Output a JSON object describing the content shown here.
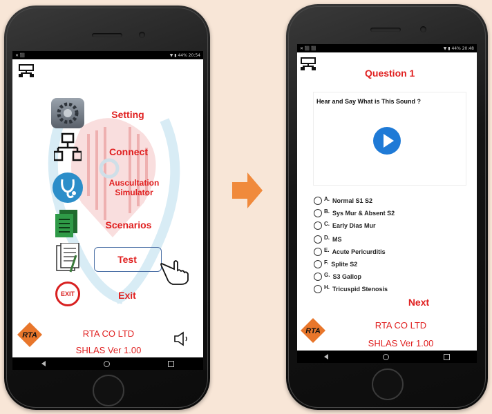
{
  "left_phone": {
    "status_left": "✕ ⬛",
    "status_right": "▼ ▮ 44% 20:54",
    "menu": [
      {
        "label": "Setting",
        "icon": "gear-icon"
      },
      {
        "label": "Connect",
        "icon": "network-icon"
      },
      {
        "label": "Auscultation Simulator",
        "icon": "stethoscope-icon"
      },
      {
        "label": "Scenarios",
        "icon": "document-icon"
      },
      {
        "label": "Test",
        "icon": "test-sheet-icon"
      },
      {
        "label": "Exit",
        "icon": "exit-icon"
      }
    ],
    "exit_badge": "EXIT",
    "company": "RTA CO LTD",
    "version": "SHLAS Ver 1.00",
    "logo_text": "RTA"
  },
  "right_phone": {
    "status_left": "✕ ⬛ ⬛",
    "status_right": "▼ ▮ 44% 20:48",
    "title": "Question 1",
    "prompt": "Hear and Say What is This Sound ?",
    "options": [
      {
        "letter": "A.",
        "text": "Normal S1 S2"
      },
      {
        "letter": "B.",
        "text": "Sys Mur & Absent S2"
      },
      {
        "letter": "C.",
        "text": "Early Dias Mur"
      },
      {
        "letter": "D.",
        "text": "MS"
      },
      {
        "letter": "E.",
        "text": "Acute Pericurditis"
      },
      {
        "letter": "F.",
        "text": "Splite S2"
      },
      {
        "letter": "G.",
        "text": "S3 Gallop"
      },
      {
        "letter": "H.",
        "text": "Tricuspid Stenosis"
      }
    ],
    "next_label": "Next",
    "company": "RTA CO LTD",
    "version": "SHLAS Ver 1.00",
    "logo_text": "RTA"
  },
  "colors": {
    "accent_red": "#e02020",
    "play_blue": "#1f7ad6",
    "arrow_orange": "#f08a3c"
  }
}
